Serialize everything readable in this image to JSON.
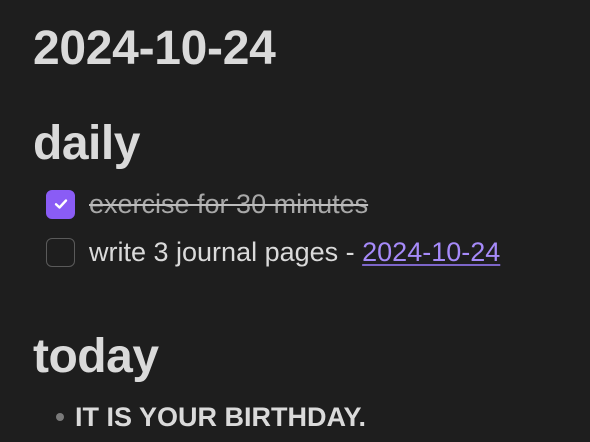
{
  "page": {
    "title": "2024-10-24"
  },
  "sections": {
    "daily": {
      "heading": "daily",
      "tasks": [
        {
          "text": "exercise for 30 minutes",
          "checked": true
        },
        {
          "text": "write 3 journal pages - ",
          "link": "2024-10-24",
          "checked": false
        }
      ]
    },
    "today": {
      "heading": "today",
      "items": [
        {
          "text": "IT IS YOUR BIRTHDAY."
        }
      ]
    }
  },
  "colors": {
    "background": "#1e1e1e",
    "text": "#dadada",
    "accent": "#8a5cf5",
    "link": "#a68af9"
  },
  "icons": {
    "checked_box": "checkmark-icon",
    "bullet": "bullet-dot-icon"
  }
}
